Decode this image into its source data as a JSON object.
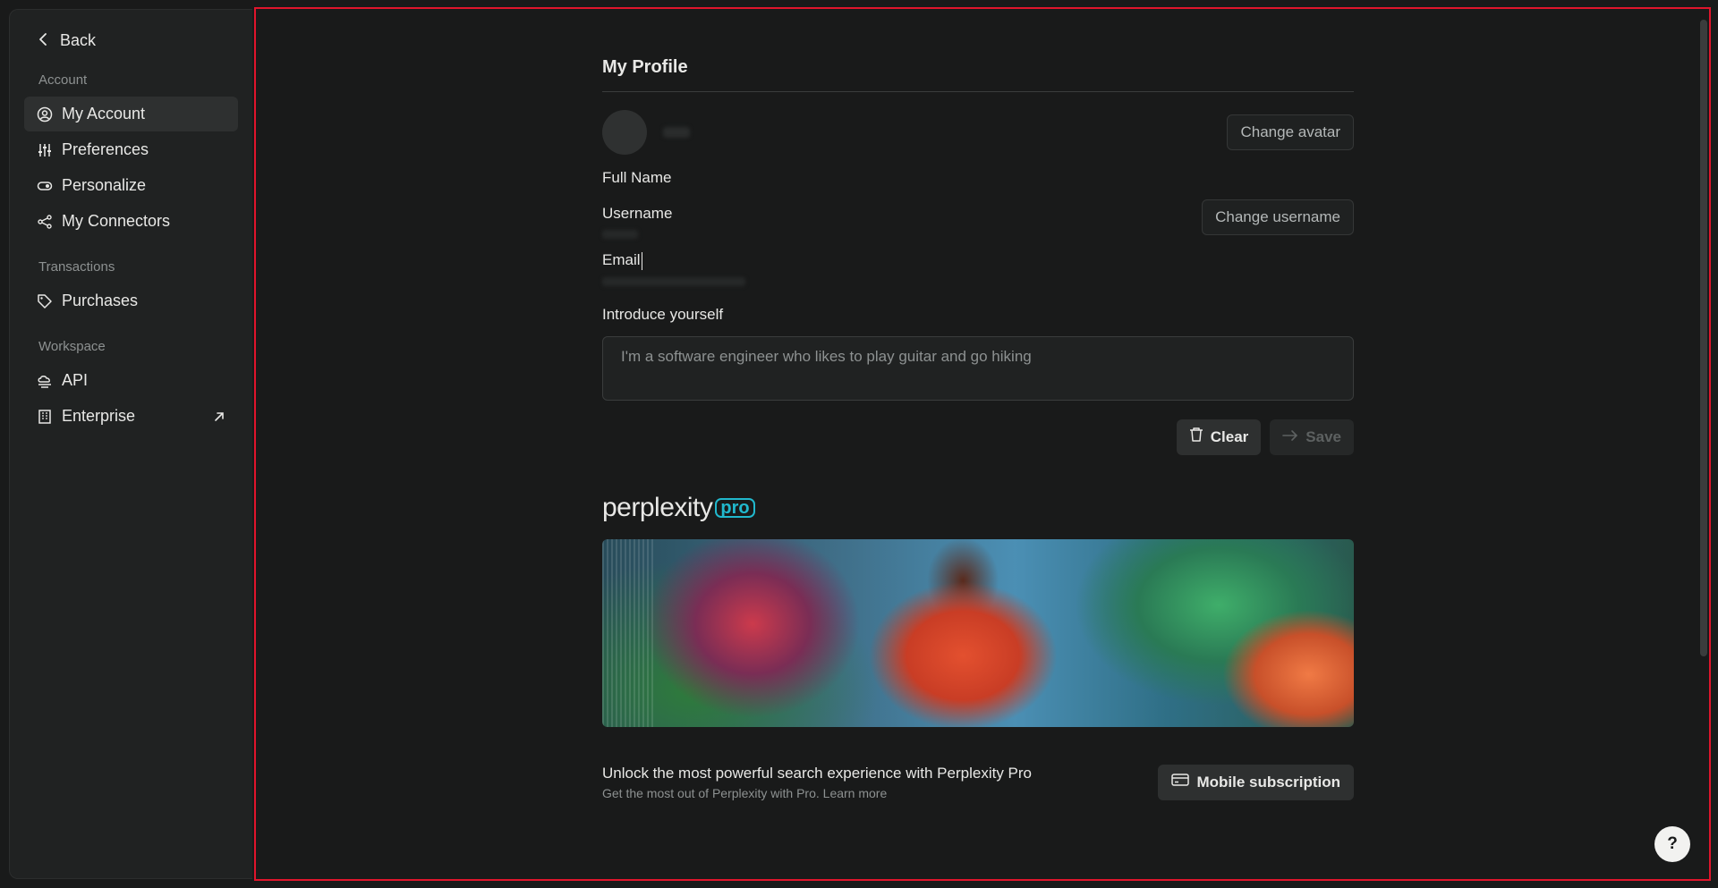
{
  "sidebar": {
    "back_label": "Back",
    "sections": {
      "account": "Account",
      "transactions": "Transactions",
      "workspace": "Workspace"
    },
    "items": {
      "my_account": "My Account",
      "preferences": "Preferences",
      "personalize": "Personalize",
      "my_connectors": "My Connectors",
      "purchases": "Purchases",
      "api": "API",
      "enterprise": "Enterprise"
    },
    "icons": {
      "back": "chevron-left-icon",
      "my_account": "user-circle-icon",
      "preferences": "sliders-icon",
      "personalize": "toggle-icon",
      "my_connectors": "share-nodes-icon",
      "purchases": "tag-icon",
      "api": "cloud-api-icon",
      "enterprise": "building-icon",
      "external": "arrow-up-right-icon"
    }
  },
  "profile": {
    "title": "My Profile",
    "change_avatar": "Change avatar",
    "full_name_label": "Full Name",
    "username_label": "Username",
    "change_username": "Change username",
    "email_label": "Email",
    "introduce_label": "Introduce yourself",
    "introduce_placeholder": "I'm a software engineer who likes to play guitar and go hiking",
    "clear_label": "Clear",
    "save_label": "Save"
  },
  "pro": {
    "brand_word": "perplexity",
    "brand_badge": "pro",
    "promo_title": "Unlock the most powerful search experience with Perplexity Pro",
    "promo_sub": "Get the most out of Perplexity with Pro. Learn more",
    "mobile_label": "Mobile subscription"
  },
  "help_label": "?",
  "colors": {
    "background": "#191a1a",
    "sidebar": "#202222",
    "accent_pro": "#21b8cd",
    "highlight_border": "#e0152c"
  }
}
